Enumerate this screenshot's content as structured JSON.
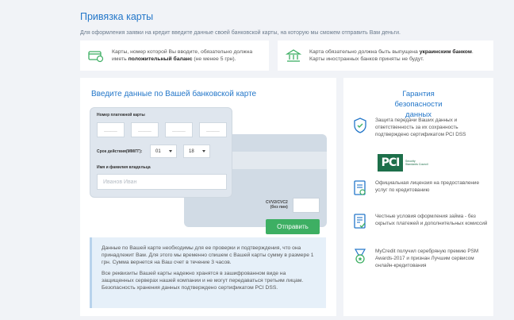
{
  "page": {
    "title": "Привязка карты",
    "subtitle": "Для оформления заявки на кредит введите данные своей банковской карты, на которую мы сможем отправить Вам деньги."
  },
  "notices": [
    {
      "icon": "credit-card-icon",
      "pre": "Карты, номер которой Вы вводите, обязательно должна иметь ",
      "bold": "положительный баланс",
      "post": " (не менее 5 грн)."
    },
    {
      "icon": "bank-icon",
      "pre": "Карта обязательно должна быть выпущена ",
      "bold": "украинским банком",
      "post": ". Карты иностранных банков приняты не будут."
    }
  ],
  "form": {
    "title": "Введите данные по Вашей банковской карте",
    "card_number_label": "Номер платежной карты",
    "card_number_placeholder": "______",
    "expiry_label": "Срок действия(ММ/ГГ):",
    "month": "01",
    "year": "18",
    "holder_label": "Имя и фамилия владельца",
    "holder_placeholder": "Иванов Иван",
    "cvv_label_1": "CVV2/CVC2",
    "cvv_label_2": "(без пин)",
    "submit_label": "Отправить"
  },
  "info": {
    "p1": "Данные по Вашей карте необходимы для ее проверки и подтверждения, что она принадлежит Вам. Для этого мы временно спишем с Вашей карты сумму в размере 1 грн. Сумма вернется на Ваш счет в течение 3 часов.",
    "p2": "Все реквизиты Вашей карты надежно хранятся в зашифрованном виде на защищенных серверах нашей компании и не могут передаваться третьим лицам. Безопасность хранения данных подтверждено сертификатом PCI DSS."
  },
  "guarantee": {
    "title": "Гарантия безопасности данных",
    "items": [
      {
        "icon": "shield-icon",
        "text": "Защита передачи Ваших данных и ответственность за их сохранность подтверждено сертификатом PCI DSS"
      },
      {
        "icon": "license-document-icon",
        "text": "Официальная лицензия на предоставление услуг по кредитованию"
      },
      {
        "icon": "conditions-document-icon",
        "text": "Честные условия оформления займа - без скрытых платежей и дополнительных комиссий"
      },
      {
        "icon": "award-icon",
        "text": "MyCredit получил серебряную премию PSM Awards-2017 и признан Лучшим сервисом онлайн-кредитования"
      }
    ],
    "pci_logo_text": "PCI",
    "pci_sub_1": "Security",
    "pci_sub_2": "Standards Council"
  },
  "colors": {
    "accent": "#2477c9",
    "button": "#3daf63",
    "background": "#f1f3f7"
  }
}
